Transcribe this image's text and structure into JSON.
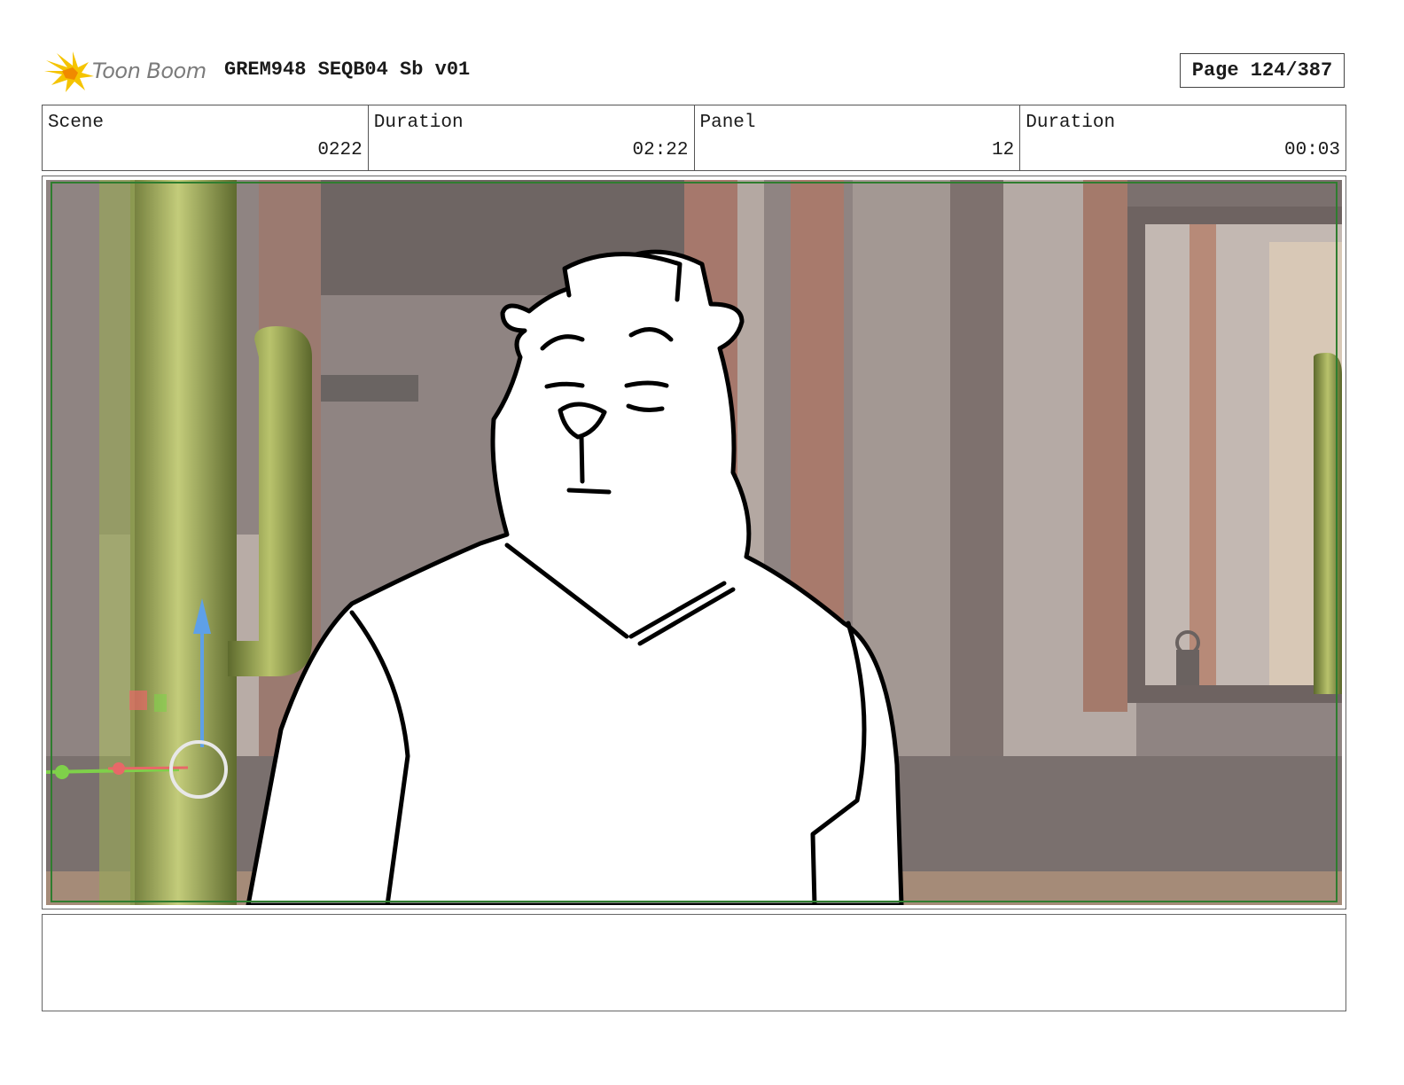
{
  "header": {
    "logo_text": "Toon Boom",
    "title": "GREM948 SEQB04 Sb v01",
    "page_label": "Page 124/387"
  },
  "info": [
    {
      "label": "Scene",
      "value": "0222"
    },
    {
      "label": "Duration",
      "value": "02:22"
    },
    {
      "label": "Panel",
      "value": "12"
    },
    {
      "label": "Duration",
      "value": "00:03"
    }
  ],
  "panel": {
    "colors": {
      "wall": "#8f8482",
      "wood": "#a6786c",
      "cactus": "#a9b45a",
      "safe_frame": "#2f7d2f",
      "gizmo_y": "#5ea0e8",
      "gizmo_x": "#e86868",
      "gizmo_z": "#7fd04a"
    }
  },
  "notes": {
    "text": ""
  }
}
